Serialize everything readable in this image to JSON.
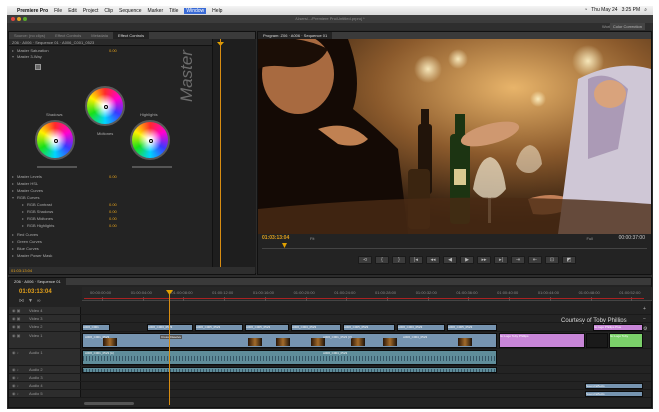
{
  "menubar": {
    "apple": "",
    "app": "Premiere Pro",
    "items": [
      "File",
      "Edit",
      "Project",
      "Clip",
      "Sequence",
      "Marker",
      "Title",
      "Window",
      "Help"
    ],
    "active_item": "Window",
    "status": [
      "Thu May 24",
      "3:25 PM"
    ]
  },
  "window": {
    "title": "/Users/.../Premiere Pro/Untitled.prproj *",
    "workspace_label": "Workspace:",
    "workspace_value": "Color Correction"
  },
  "effect_controls": {
    "tabs": [
      "Source: (no clips)",
      "Effect Controls",
      "Metadata",
      "Effect Controls"
    ],
    "clip_header": "Z06 · A006 · Sequence 01 · A006_C001_0523",
    "rows": [
      {
        "label": "Master Saturation",
        "value": "0.00"
      },
      {
        "label": "Master 3-Way",
        "value": ""
      },
      {
        "label": "Master Levels",
        "value": "0.00"
      },
      {
        "label": "Master HSL",
        "value": ""
      },
      {
        "label": "Master Curves",
        "value": ""
      },
      {
        "label": "RGB Curves",
        "value": ""
      },
      {
        "label": "RGB Contrast",
        "value": "0.00"
      },
      {
        "label": "RGB Shadows",
        "value": "0.00"
      },
      {
        "label": "RGB Midtones",
        "value": "0.00"
      },
      {
        "label": "RGB Highlights",
        "value": "0.00"
      },
      {
        "label": "Red Curves",
        "value": ""
      },
      {
        "label": "Green Curves",
        "value": ""
      },
      {
        "label": "Blue Curves",
        "value": ""
      },
      {
        "label": "Master Power Mask",
        "value": ""
      }
    ],
    "wheels": {
      "shadows": "Shadows",
      "midtones": "Midtones",
      "highlights": "Highlights"
    },
    "watermark": "Master",
    "status_timecode": "01:03:13:04"
  },
  "program": {
    "tab": "Program: Z06 · A006 · Sequence 01",
    "timecode_left": "01:03:13:04",
    "fit": "Fit",
    "resolution": "Full",
    "timecode_right": "00:00:37:00",
    "controls": [
      "⊲",
      "{",
      "}",
      "|◂",
      "◂◂",
      "◀",
      "▶",
      "▸▸",
      "▸|",
      "⇥",
      "⇤",
      "⊡",
      "◩"
    ]
  },
  "timeline": {
    "tab": "Z06 · A006 · Sequence 01",
    "timecode": "01:03:13:04",
    "ruler_labels": [
      "00:00:00:00",
      "01:00:04:00",
      "01:00:08:00",
      "01:00:12:00",
      "01:00:16:00",
      "01:00:20:00",
      "01:00:24:00",
      "01:00:28:00",
      "01:00:32:00",
      "01:00:36:00",
      "01:00:40:00",
      "01:00:44:00",
      "01:00:48:00",
      "01:00:52:00"
    ],
    "courtesy": "Courtesy of Toby Phillips",
    "tracks": [
      {
        "name": "Video 4"
      },
      {
        "name": "Video 3"
      },
      {
        "name": "Video 2"
      },
      {
        "name": "Video 1"
      },
      {
        "name": "Audio 1"
      },
      {
        "name": "Audio 2"
      },
      {
        "name": "Audio 3"
      },
      {
        "name": "Audio 4"
      },
      {
        "name": "Audio 5"
      }
    ],
    "clip_names": {
      "v2a": "A006_C001",
      "v2b": "A006_C003_0523",
      "v2c": "A006_C005_0523",
      "v1a": "A006_C001_0523",
      "v1b": "Cross Dissolve",
      "v1c": "A006_C001_0523 [V]",
      "v1d": "A006_C004_0523",
      "m1": "Gr-Logo Toby Phillips",
      "m2": "Gr-logo Phillips Plus",
      "g1": "Gr-Logo Toby",
      "a1": "A006_C001_0523 [A]",
      "a2": "A006_C004_0523",
      "a5": "Sound Effects"
    }
  },
  "colors": {
    "accent": "#e4a11b",
    "playhead": "#d88d12",
    "video_clip": "#7694b0",
    "audio_clip": "#5f8d9a",
    "title_clip": "#c886d8",
    "graphic_clip": "#7bd06a"
  }
}
